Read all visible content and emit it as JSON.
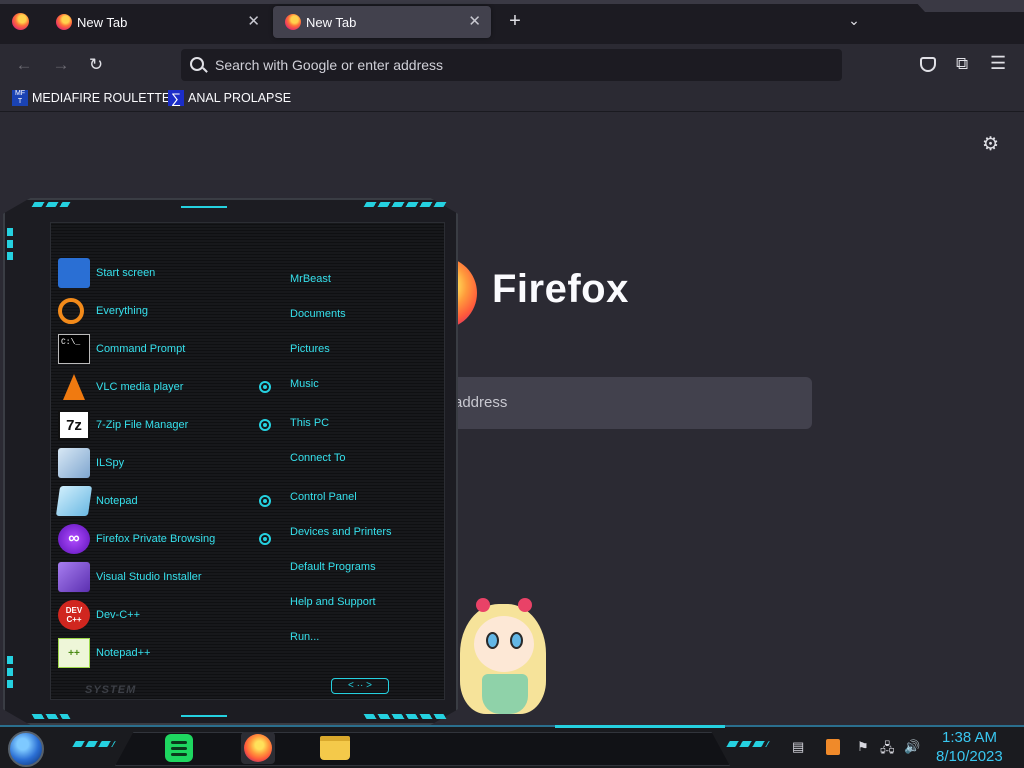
{
  "browser": {
    "tabs": [
      {
        "label": "New Tab"
      },
      {
        "label": "New Tab"
      }
    ],
    "close_glyph": "✕",
    "newtab_glyph": "+",
    "tablist_glyph": "⌄",
    "address_placeholder": "Search with Google or enter address",
    "bookmarks": [
      {
        "label": "MEDIAFIRE ROULETTER",
        "icon_text": "MF T"
      },
      {
        "label": "ANAL PROLAPSE",
        "icon_text": "∑"
      }
    ],
    "nav_glyphs": {
      "back": "←",
      "forward": "→",
      "reload": "↻"
    }
  },
  "newtab": {
    "logo_text": "Firefox",
    "search_placeholder_visible": "address",
    "settings_glyph": "⚙"
  },
  "start_menu": {
    "programs": [
      {
        "label": "Start screen",
        "icon": "start-screen-icon",
        "icon_text": "",
        "color": "#2a6fd4"
      },
      {
        "label": "Everything",
        "icon": "magnifier-icon",
        "icon_text": "",
        "color": "#f28a1a"
      },
      {
        "label": "Command Prompt",
        "icon": "terminal-icon",
        "icon_text": "C:\\_",
        "color": "#000000"
      },
      {
        "label": "VLC media player",
        "icon": "vlc-cone-icon",
        "icon_text": "",
        "color": "#f07a10"
      },
      {
        "label": "7-Zip File Manager",
        "icon": "7zip-icon",
        "icon_text": "7z",
        "color": "#111111"
      },
      {
        "label": "ILSpy",
        "icon": "ilspy-icon",
        "icon_text": "",
        "color": "#9ab8d8"
      },
      {
        "label": "Notepad",
        "icon": "notepad-icon",
        "icon_text": "",
        "color": "#8fd0f0"
      },
      {
        "label": "Firefox Private Browsing",
        "icon": "private-browsing-icon",
        "icon_text": "∞",
        "color": "#7b1fd4"
      },
      {
        "label": "Visual Studio Installer",
        "icon": "visual-studio-icon",
        "icon_text": "",
        "color": "#7a4ac8"
      },
      {
        "label": "Dev-C++",
        "icon": "devcpp-icon",
        "icon_text": "DEV C++",
        "color": "#d0261f"
      },
      {
        "label": "Notepad++",
        "icon": "notepadpp-icon",
        "icon_text": "++",
        "color": "#9ed84a"
      }
    ],
    "places": [
      {
        "label": "MrBeast"
      },
      {
        "label": "Documents"
      },
      {
        "label": "Pictures"
      },
      {
        "label": "Music"
      },
      {
        "label": "This PC"
      },
      {
        "label": "Connect To"
      },
      {
        "label": "Control Panel"
      },
      {
        "label": "Devices and Printers"
      },
      {
        "label": "Default Programs"
      },
      {
        "label": "Help and Support"
      },
      {
        "label": "Run..."
      }
    ],
    "system_label": "SYSTEM",
    "arrows_text": "< ·· >"
  },
  "taskbar": {
    "time": "1:38 AM",
    "date": "8/10/2023",
    "tray_icons": [
      "sublime-text-icon",
      "flag-icon",
      "network-icon",
      "speaker-icon"
    ]
  },
  "colors": {
    "accent_cyan": "#25d1e0",
    "menu_text": "#36e0ec",
    "clock": "#39c7f0",
    "browser_bg": "#2b2a33"
  }
}
